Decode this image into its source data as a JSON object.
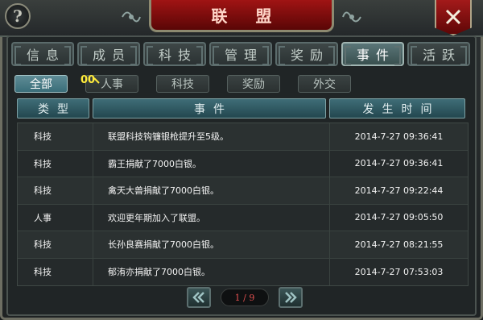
{
  "header": {
    "title": "联 盟",
    "help_symbol": "?",
    "close_symbol": "X"
  },
  "tabs": [
    {
      "label": "信息",
      "active": false
    },
    {
      "label": "成员",
      "active": false
    },
    {
      "label": "科技",
      "active": false
    },
    {
      "label": "管理",
      "active": false
    },
    {
      "label": "奖励",
      "active": false
    },
    {
      "label": "事件",
      "active": true
    },
    {
      "label": "活跃",
      "active": false
    }
  ],
  "filters": [
    {
      "label": "全部",
      "active": true
    },
    {
      "label": "人事",
      "active": false
    },
    {
      "label": "科技",
      "active": false
    },
    {
      "label": "奖励",
      "active": false
    },
    {
      "label": "外交",
      "active": false
    }
  ],
  "badge_text": "00",
  "table": {
    "headers": [
      "类型",
      "事件",
      "发生时间"
    ],
    "rows": [
      {
        "type": "科技",
        "event": "联盟科技钩镰银枪提升至5级。",
        "time": "2014-7-27 09:36:41"
      },
      {
        "type": "科技",
        "event": "霸王捐献了7000白银。",
        "time": "2014-7-27 09:36:41"
      },
      {
        "type": "科技",
        "event": "禽天大兽捐献了7000白银。",
        "time": "2014-7-27 09:22:44"
      },
      {
        "type": "人事",
        "event": "欢迎更年期加入了联盟。",
        "time": "2014-7-27 09:05:50"
      },
      {
        "type": "科技",
        "event": "长孙良赛捐献了7000白银。",
        "time": "2014-7-27 08:21:55"
      },
      {
        "type": "科技",
        "event": "郁洧亦捐献了7000白银。",
        "time": "2014-7-27 07:53:03"
      }
    ]
  },
  "pagination": {
    "text": "1 / 9"
  },
  "colors": {
    "title_red": "#a01414",
    "active_tab": "#5a7578",
    "active_filter": "#5f8c96",
    "header_teal": "#3f6d77",
    "page_text": "#e25050",
    "badge_yellow": "#ffec3b"
  }
}
